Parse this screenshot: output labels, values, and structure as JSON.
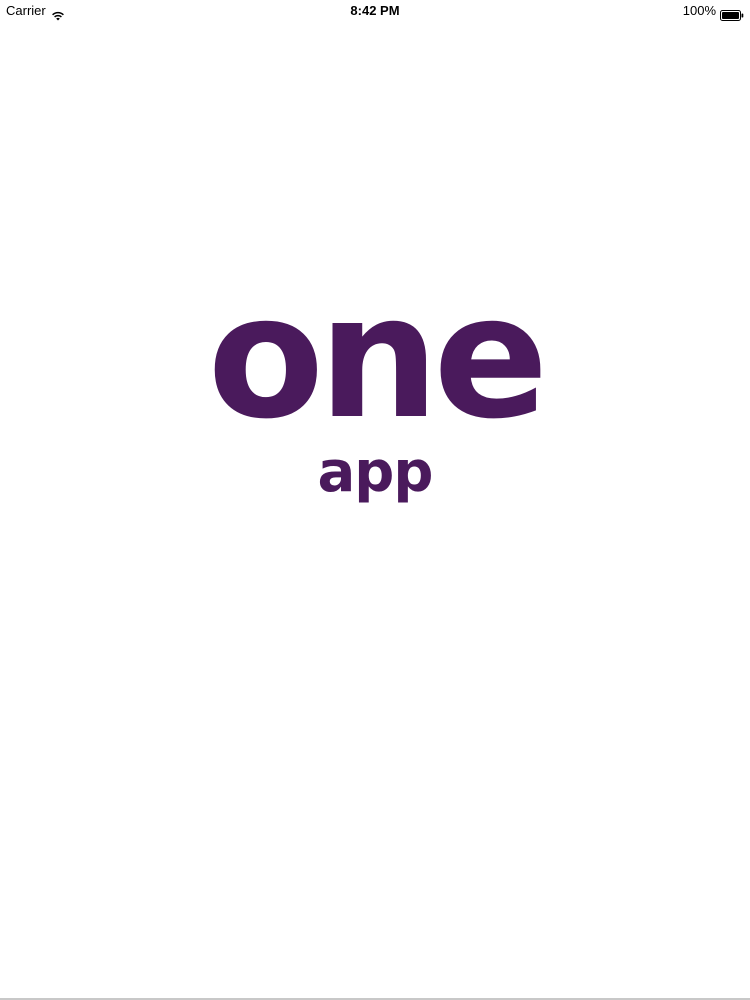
{
  "status_bar": {
    "carrier": "Carrier",
    "wifi_icon": "wifi-icon",
    "time": "8:42 PM",
    "battery_percent": "100%",
    "battery_icon": "battery-full-icon"
  },
  "splash": {
    "logo_word": "one",
    "logo_subword": "app",
    "brand_color": "#4a1a5c"
  }
}
